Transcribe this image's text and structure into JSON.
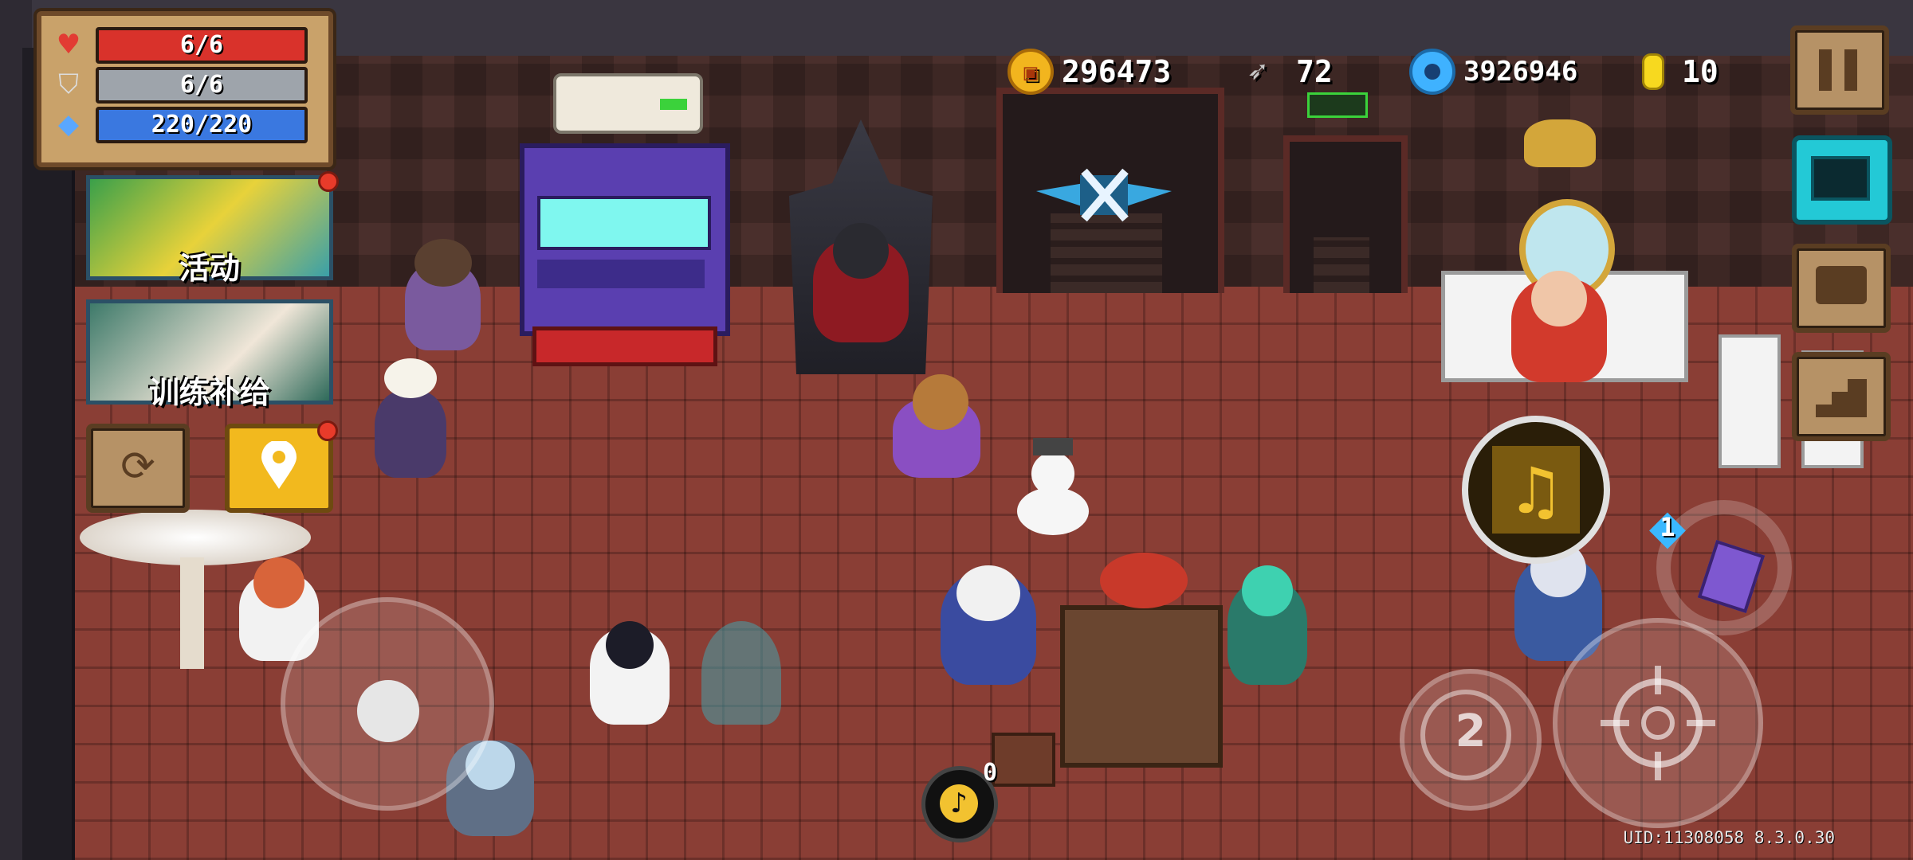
{
  "status": {
    "hp": "6/6",
    "armor": "6/6",
    "energy": "220/220"
  },
  "currency": {
    "gold": "296473",
    "fish": "72",
    "gems": "3926946",
    "tokens": "10"
  },
  "buttons": {
    "event_label": "活动",
    "training_label": "训练补给"
  },
  "hud": {
    "skill_charges": "1",
    "skill_count": "2",
    "music_count": "0",
    "uid": "UID:11308058 8.3.0.30"
  },
  "colors": {
    "hp": "#d9322b",
    "armor": "#9ea4ab",
    "energy": "#3a78e0",
    "panel": "#c9a26a",
    "floor": "#8a3e35",
    "event_button": "#f2b91e"
  },
  "icons": [
    "heart-icon",
    "shield-icon",
    "diamond-icon",
    "gold-coin-icon",
    "fish-icon",
    "gem-icon",
    "token-icon",
    "pause-icon",
    "monitor-icon",
    "profile-card-icon",
    "stairs-icon",
    "refresh-icon",
    "location-pin-icon",
    "music-note-icon",
    "card-icon",
    "crosshair-icon",
    "skill-swap-icon"
  ]
}
